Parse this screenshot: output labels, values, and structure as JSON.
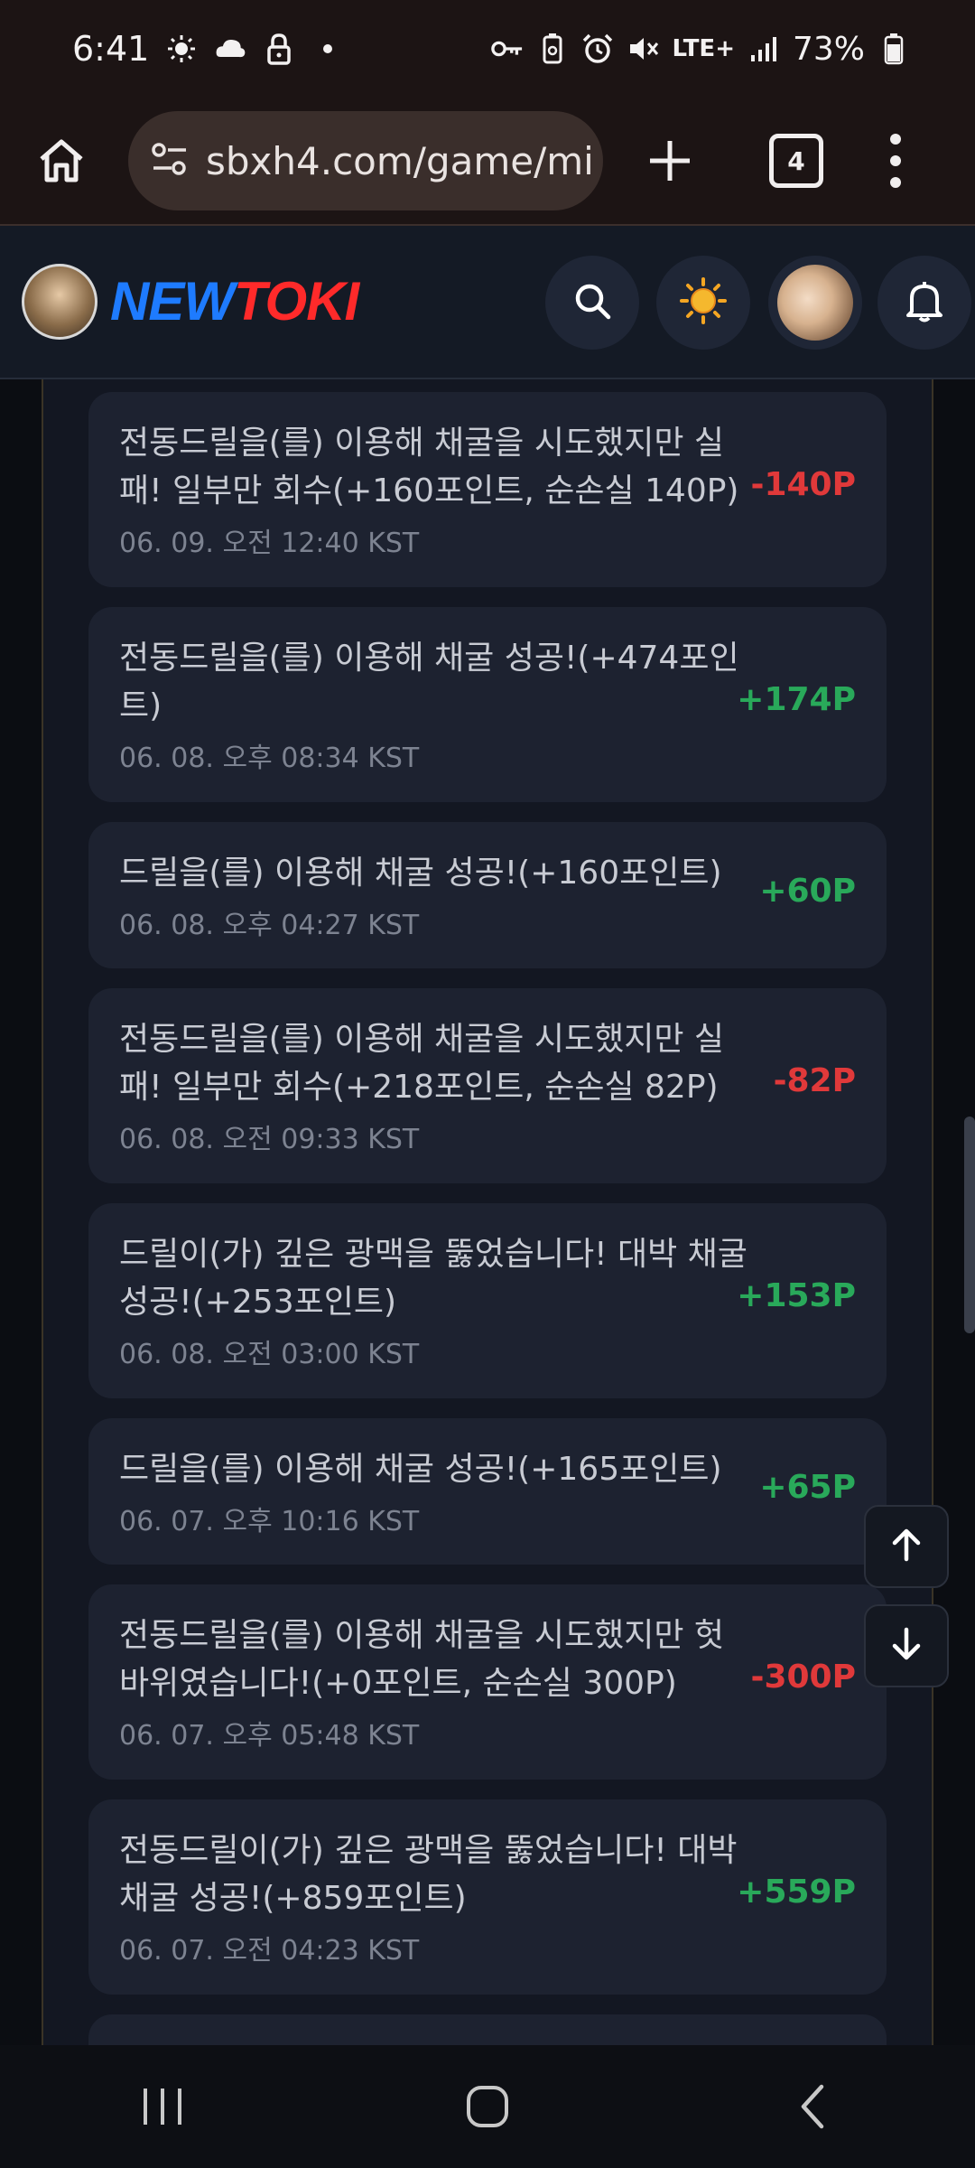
{
  "status_bar": {
    "time": "6:41",
    "network": "LTE+",
    "battery": "73%"
  },
  "browser": {
    "url": "sbxh4.com/game/mi",
    "tab_count": "4"
  },
  "site": {
    "logo_part1": "NEW",
    "logo_part2": "TOKI"
  },
  "colors": {
    "negative": "#e0393a",
    "positive": "#29a95a",
    "card_bg": "#1d2230"
  },
  "log": [
    {
      "message": "전동드릴을(를) 이용해 채굴을 시도했지만 실패! 일부만 회수(+160포인트, 순손실 140P)",
      "time": "06. 09. 오전 12:40 KST",
      "points": "-140P",
      "sign": "negative"
    },
    {
      "message": "전동드릴을(를) 이용해 채굴 성공!(+474포인트)",
      "time": "06. 08. 오후 08:34 KST",
      "points": "+174P",
      "sign": "positive"
    },
    {
      "message": "드릴을(를) 이용해 채굴 성공!(+160포인트)",
      "time": "06. 08. 오후 04:27 KST",
      "points": "+60P",
      "sign": "positive"
    },
    {
      "message": "전동드릴을(를) 이용해 채굴을 시도했지만 실패! 일부만 회수(+218포인트, 순손실 82P)",
      "time": "06. 08. 오전 09:33 KST",
      "points": "-82P",
      "sign": "negative"
    },
    {
      "message": "드릴이(가) 깊은 광맥을 뚫었습니다! 대박 채굴 성공!(+253포인트)",
      "time": "06. 08. 오전 03:00 KST",
      "points": "+153P",
      "sign": "positive"
    },
    {
      "message": "드릴을(를) 이용해 채굴 성공!(+165포인트)",
      "time": "06. 07. 오후 10:16 KST",
      "points": "+65P",
      "sign": "positive"
    },
    {
      "message": "전동드릴을(를) 이용해 채굴을 시도했지만 헛바위였습니다!(+0포인트, 순손실 300P)",
      "time": "06. 07. 오후 05:48 KST",
      "points": "-300P",
      "sign": "negative"
    },
    {
      "message": "전동드릴이(가) 깊은 광맥을 뚫었습니다! 대박 채굴 성공!(+859포인트)",
      "time": "06. 07. 오전 04:23 KST",
      "points": "+559P",
      "sign": "positive"
    }
  ]
}
